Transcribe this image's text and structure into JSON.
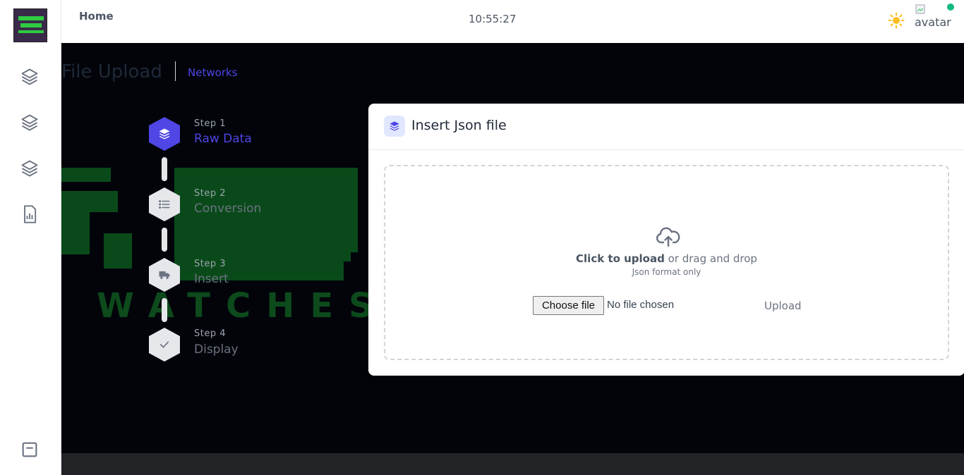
{
  "header": {
    "home_label": "Home",
    "time": "10:55:27",
    "avatar_alt": "avatar",
    "status_color": "#10b981"
  },
  "sidebar": {
    "items": [
      {
        "icon": "layers-icon"
      },
      {
        "icon": "layers-icon"
      },
      {
        "icon": "layers-icon"
      },
      {
        "icon": "report-icon"
      }
    ],
    "bottom_icon": "window-minimize-icon"
  },
  "page": {
    "title": "File Upload",
    "breadcrumb": "Networks"
  },
  "stepper": {
    "steps": [
      {
        "number": "Step 1",
        "name": "Raw Data",
        "icon": "layers-icon",
        "state": "active"
      },
      {
        "number": "Step 2",
        "name": "Conversion",
        "icon": "list-icon",
        "state": "pending"
      },
      {
        "number": "Step 3",
        "name": "Insert",
        "icon": "truck-icon",
        "state": "pending"
      },
      {
        "number": "Step 4",
        "name": "Display",
        "icon": "check-icon",
        "state": "pending"
      }
    ]
  },
  "card": {
    "title": "Insert Json file",
    "dropzone": {
      "click_text": "Click to upload",
      "rest_text": " or drag and drop",
      "hint": "Json format only"
    },
    "choose_file_label": "Choose file",
    "no_file_label": "No file chosen",
    "upload_label": "Upload"
  },
  "colors": {
    "accent": "#4f46e5",
    "background": "#02040a"
  }
}
